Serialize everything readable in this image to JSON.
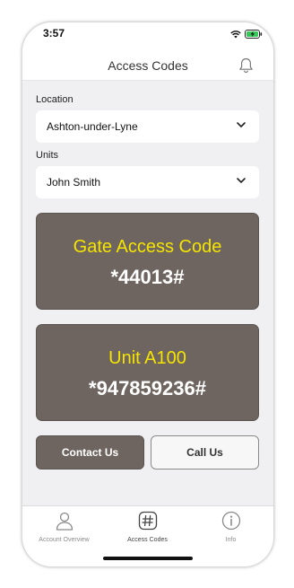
{
  "status_bar": {
    "time": "3:57"
  },
  "header": {
    "title": "Access Codes"
  },
  "location": {
    "label": "Location",
    "value": "Ashton-under-Lyne"
  },
  "units": {
    "label": "Units",
    "value": "John Smith"
  },
  "cards": [
    {
      "title": "Gate Access Code",
      "code": "*44013#"
    },
    {
      "title": "Unit A100",
      "code": "*947859236#"
    }
  ],
  "buttons": {
    "contact": "Contact Us",
    "call": "Call Us"
  },
  "tabs": [
    {
      "label": "Account Overview",
      "icon": "person-icon"
    },
    {
      "label": "Access Codes",
      "icon": "hashtag-icon",
      "active": true
    },
    {
      "label": "Info",
      "icon": "info-icon"
    }
  ],
  "colors": {
    "card_bg": "#6e6560",
    "card_title": "#f5e400",
    "background": "#f0f0f2"
  }
}
